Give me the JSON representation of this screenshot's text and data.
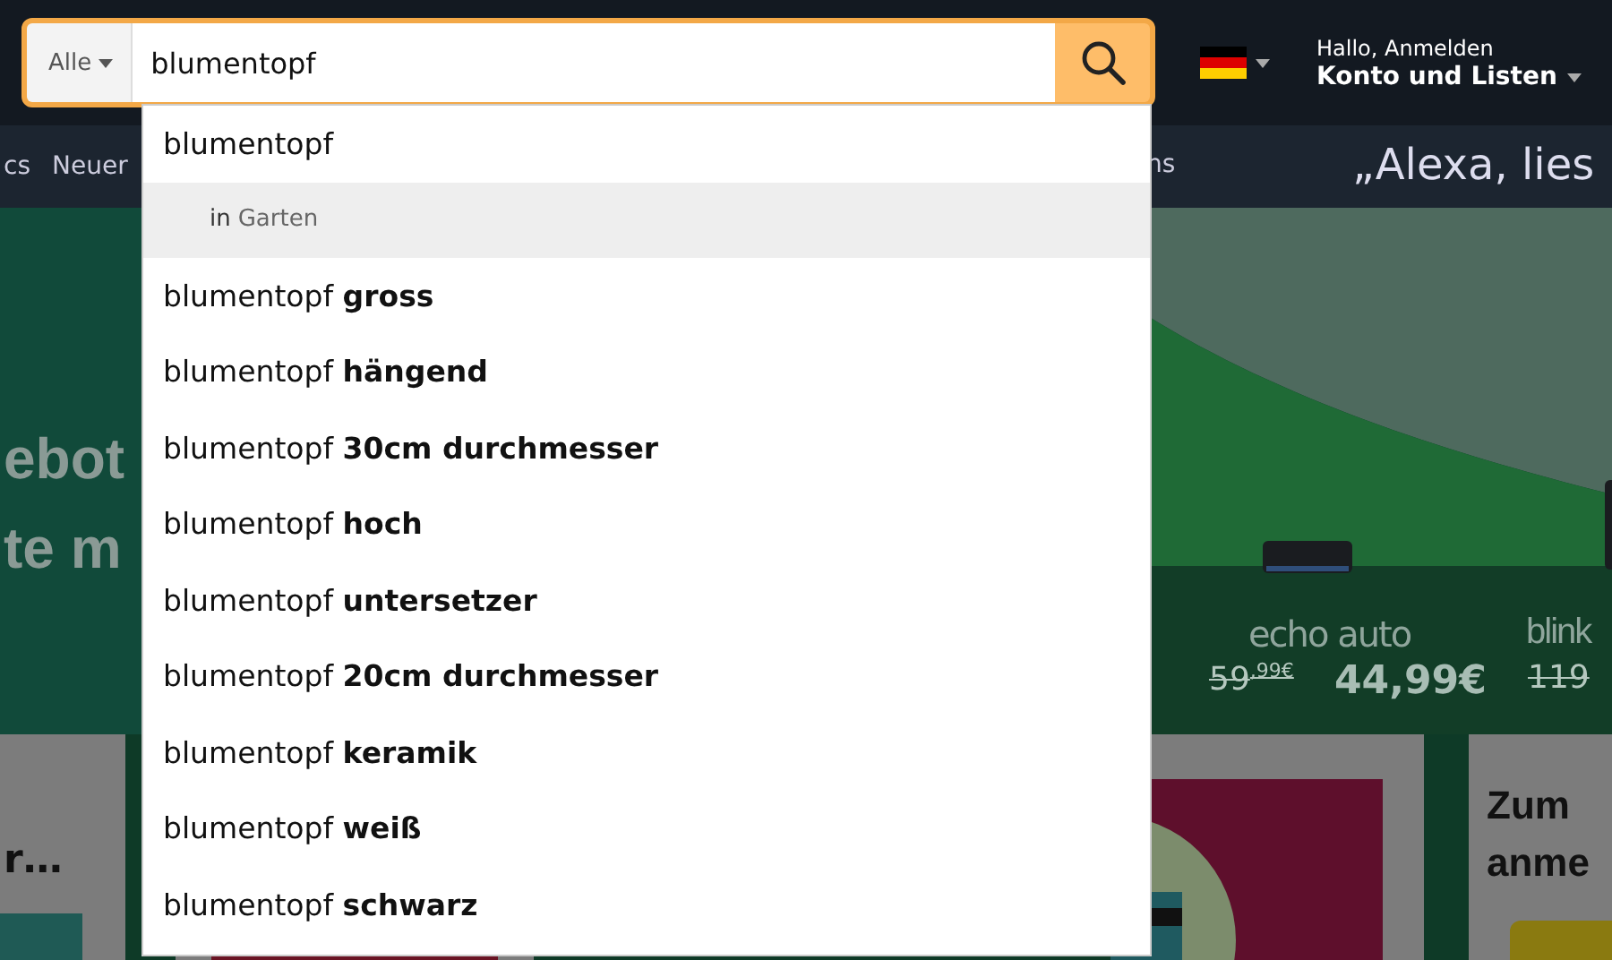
{
  "header": {
    "search": {
      "category": "Alle",
      "value": "blumentopf"
    },
    "account": {
      "greeting": "Hallo, Anmelden",
      "label": "Konto und Listen"
    }
  },
  "suggestions": [
    {
      "kind": "query",
      "text": "blumentopf"
    },
    {
      "kind": "department",
      "prefix": "in",
      "text": "Garten"
    },
    {
      "kind": "query",
      "text": "blumentopf **gross**"
    },
    {
      "kind": "query",
      "text": "blumentopf **hängend**"
    },
    {
      "kind": "query",
      "text": "blumentopf **30cm durchmesser**"
    },
    {
      "kind": "query",
      "text": "blumentopf **hoch**"
    },
    {
      "kind": "query",
      "text": "blumentopf **untersetzer**"
    },
    {
      "kind": "query",
      "text": "blumentopf **20cm durchmesser**"
    },
    {
      "kind": "query",
      "text": "blumentopf **keramik**"
    },
    {
      "kind": "query",
      "text": "blumentopf **weiß**"
    },
    {
      "kind": "query",
      "text": "blumentopf **schwarz**"
    }
  ],
  "nav": {
    "left_items": [
      "cs",
      "Neuer"
    ],
    "right_items": [
      "ns"
    ],
    "promo": "„Alexa, lies"
  },
  "hero": {
    "headline_lines": [
      "ebot",
      "te m"
    ],
    "products": [
      {
        "name": "echo auto",
        "old_price": "59$^{,99€}$",
        "price": "44,99€"
      },
      {
        "name": "blink",
        "old_price": "119"
      }
    ]
  },
  "cards": [
    {
      "text": "r…"
    },
    {
      "title_lines": [
        "Zum",
        "anme"
      ]
    }
  ]
}
